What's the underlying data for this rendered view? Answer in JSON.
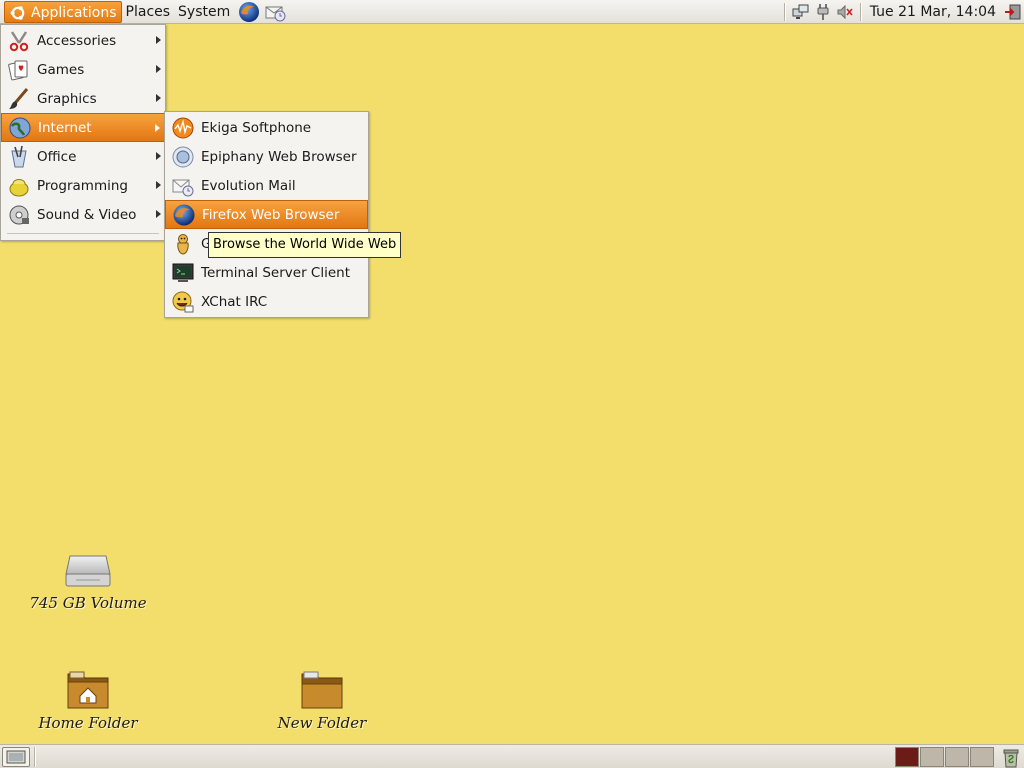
{
  "top_panel": {
    "menus": [
      "Applications",
      "Places",
      "System"
    ],
    "launchers": [
      "firefox-launcher-icon",
      "evolution-launcher-icon"
    ],
    "tray_icons": [
      "network-icon",
      "power-icon",
      "volume-muted-icon"
    ],
    "clock": "Tue 21 Mar, 14:04"
  },
  "applications_menu": {
    "items": [
      {
        "label": "Accessories",
        "icon": "accessories-icon"
      },
      {
        "label": "Games",
        "icon": "games-icon"
      },
      {
        "label": "Graphics",
        "icon": "graphics-icon"
      },
      {
        "label": "Internet",
        "icon": "internet-icon"
      },
      {
        "label": "Office",
        "icon": "office-icon"
      },
      {
        "label": "Programming",
        "icon": "programming-icon"
      },
      {
        "label": "Sound & Video",
        "icon": "sound-video-icon"
      }
    ],
    "highlighted": "Internet"
  },
  "internet_submenu": {
    "items": [
      {
        "label": "Ekiga Softphone",
        "icon": "ekiga-icon"
      },
      {
        "label": "Epiphany Web Browser",
        "icon": "epiphany-icon"
      },
      {
        "label": "Evolution Mail",
        "icon": "evolution-icon"
      },
      {
        "label": "Firefox Web Browser",
        "icon": "firefox-icon"
      },
      {
        "label": "G",
        "icon": "gaim-icon"
      },
      {
        "label": "Terminal Server Client",
        "icon": "terminal-server-icon"
      },
      {
        "label": "XChat IRC",
        "icon": "xchat-icon"
      }
    ],
    "highlighted": "Firefox Web Browser"
  },
  "tooltip": "Browse the World Wide Web",
  "desktop_icons": [
    {
      "label": "745 GB Volume",
      "icon": "hard-drive-icon"
    },
    {
      "label": "Home Folder",
      "icon": "home-folder-icon"
    },
    {
      "label": "New Folder",
      "icon": "folder-icon"
    }
  ],
  "colors": {
    "desktop": "#f3de6b",
    "highlight": "#e8821a",
    "active_workspace": "#6b1c17"
  }
}
